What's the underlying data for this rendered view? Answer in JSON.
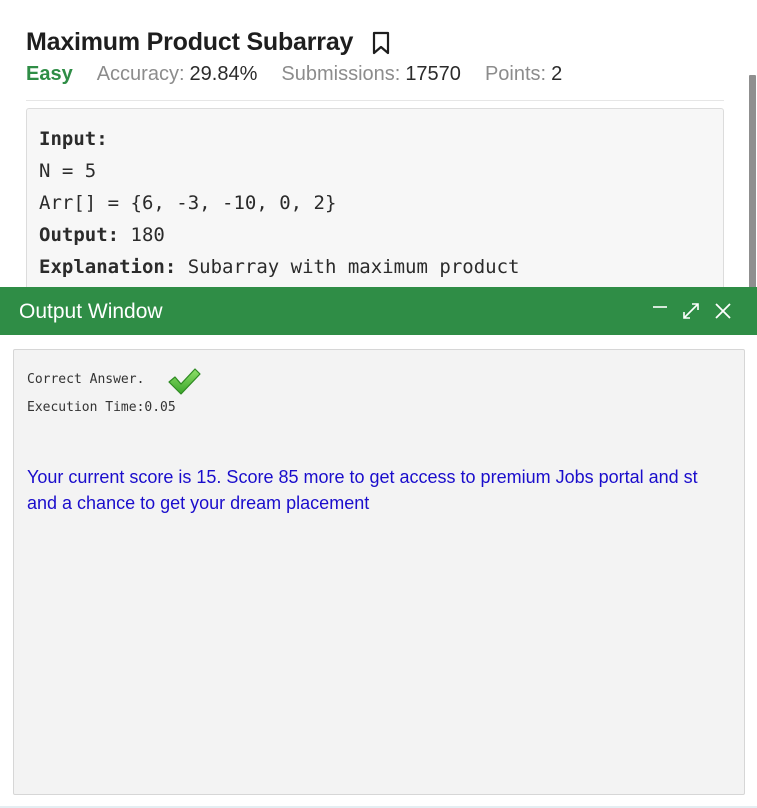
{
  "problem": {
    "title": "Maximum Product Subarray",
    "difficulty": "Easy",
    "accuracy_label": "Accuracy:",
    "accuracy_value": "29.84%",
    "submissions_label": "Submissions:",
    "submissions_value": "17570",
    "points_label": "Points:",
    "points_value": "2",
    "example": {
      "input_label": "Input:",
      "line_n": "N = 5",
      "line_arr": "Arr[] = {6, -3, -10, 0, 2}",
      "output_label": "Output:",
      "output_value": " 180",
      "explanation_label": "Explanation:",
      "explanation_value": " Subarray with maximum product"
    }
  },
  "output_window": {
    "title": "Output Window",
    "controls": [
      "minimize-icon",
      "expand-icon",
      "close-icon"
    ],
    "result": "Correct Answer.",
    "execution_time": "Execution Time:0.05",
    "score_line_1": "Your current score is 15. Score 85 more to get access to premium Jobs portal and st",
    "score_line_2": "and a chance to get your dream placement"
  },
  "colors": {
    "accent_green": "#2f8d46",
    "link_blue": "#1a0dcc",
    "check_green": "#5cc13a"
  }
}
